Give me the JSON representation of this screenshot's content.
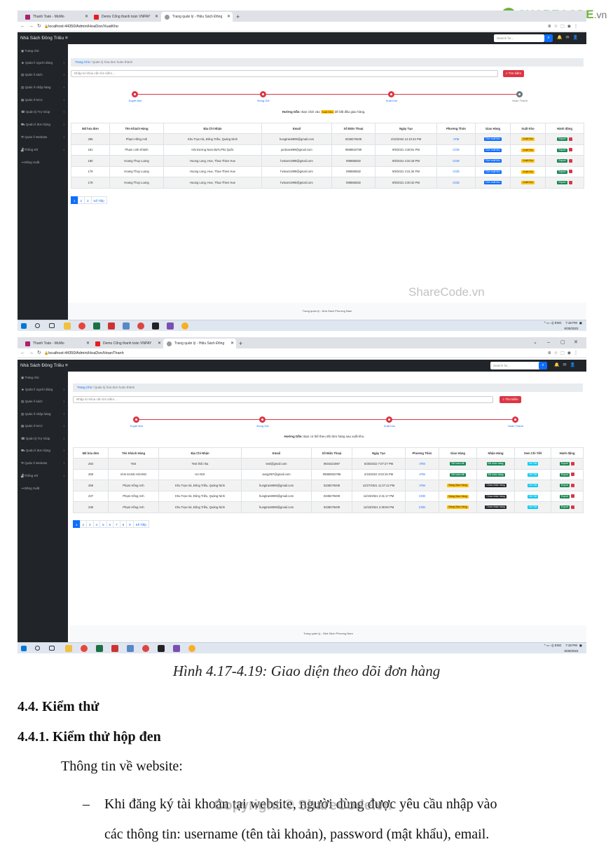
{
  "logo": {
    "brand": "SHARECODE",
    "tld": ".vn"
  },
  "shots": [
    {
      "tabs": [
        "Thanh Toán - MoMo",
        "Demo Cổng thanh toán VNPAY",
        "Trang quản lý - Hiệu Sách Đông"
      ],
      "url": "localhost:44350/Admin/HoaDon/XuatKho",
      "brand": "Nhà Sách Đông Triều",
      "search_placeholder": "Search for...",
      "sidebar": [
        "Trang chủ",
        "Quản lí người dùng",
        "Quản lí sách",
        "Quản lí nhập hàng",
        "Quản lí NCC",
        "Quản lý Trợ Giúp",
        "Quản lí đơn hàng",
        "Quản lí Website",
        "Thống Kê",
        "Đăng Xuất"
      ],
      "breadcrumb_home": "Trang Chủ",
      "breadcrumb_current": "Quản lý hóa đơn hoàn thành",
      "keyword_placeholder": "Nhập từ khóa cần tìm kiếm...",
      "search_button": "Tìm kiếm",
      "steps": [
        "Duyệt đơn",
        "Đóng Gói",
        "Xuất Kho",
        "Hoàn Thành"
      ],
      "guide_label": "Hướng Dẫn:",
      "guide_pre": "Bạn click vào",
      "guide_hl": "Xuất Kho",
      "guide_post": "để bắt đầu giao hàng.",
      "headers": [
        "Mã hóa đơn",
        "Tên Khách Hàng",
        "Địa Chỉ Nhận",
        "Email",
        "Số Điện Thoại",
        "Ngày Tạo",
        "Phương Thức",
        "Giao Hàng",
        "Xuất Kho",
        "Hành động"
      ],
      "rows": [
        [
          "266",
          "Phạm Hồng Anh",
          "Khu Trạo Hà, Đông Triều, Quảng Ninh",
          "hungtran8909@gmail.com",
          "0338279409",
          "1/22/2022 12:10:42 PM",
          "ATM",
          "Chờ xuất kho",
          "Xuất Kho",
          "Export"
        ],
        [
          "181",
          "Phạm Linh Khánh",
          "Hải Dương Nam Định,Phú Quốc",
          "jackson899@gmail.com",
          "0888932789",
          "9/5/2021 4:38:01 PM",
          "COD",
          "Chờ xuất kho",
          "Xuất Kho",
          "Export"
        ],
        [
          "180",
          "Hoang Thuy Luong",
          "Huong Long, Hue, Thua Thien Hue",
          "hvtnam1999@gmail.com",
          "098588282",
          "9/5/2021 4:32:18 PM",
          "COD",
          "Chờ xuất kho",
          "Xuất Kho",
          "Export"
        ],
        [
          "179",
          "Hoang Thuy Luong",
          "Huong Long, Hue, Thua Thien Hue",
          "hvtnam1999@gmail.com",
          "098588282",
          "9/5/2021 4:31:34 PM",
          "COD",
          "Chờ xuất kho",
          "Xuất Kho",
          "Export"
        ],
        [
          "178",
          "Hoang Thuy Luong",
          "Huong Long, Hue, Thua Thien Hue",
          "hvtnam1999@gmail.com",
          "098588282",
          "9/5/2021 4:30:42 PM",
          "COD",
          "Chờ xuất kho",
          "Xuất Kho",
          "Export"
        ]
      ],
      "pages": [
        "1",
        "2",
        "3",
        "Kế Tiếp"
      ],
      "footer": "Trang quản lý - Nhà Sách Phương Nam",
      "watermark": "ShareCode.vn",
      "tray_lang": "ENG",
      "clock_time": "7:18 PM",
      "clock_date": "6/30/2022"
    },
    {
      "tabs": [
        "Thanh Toán - MoMo",
        "Demo Cổng thanh toán VNPAY",
        "Trang quản lý - Hiệu Sách Đông"
      ],
      "url": "localhost:44350/Admin/HoaDon/HoanThanh",
      "brand": "Nhà Sách Đông Triều",
      "search_placeholder": "Search for...",
      "sidebar": [
        "Trang chủ",
        "Quản lí người dùng",
        "Quản lí sách",
        "Quản lí nhập hàng",
        "Quản lí NCC",
        "Quản lý Trợ Giúp",
        "Quản lí đơn hàng",
        "Quản lí Website",
        "Thống Kê",
        "Đăng Xuất"
      ],
      "breadcrumb_home": "Trang Chủ",
      "breadcrumb_current": "Quản lý hóa đơn hoàn thành",
      "keyword_placeholder": "Nhập từ khóa cần tìm kiếm...",
      "search_button": "Tìm kiếm",
      "steps": [
        "Duyệt đơn",
        "Đóng Gói",
        "Xuất Kho",
        "Hoàn Thành"
      ],
      "guide_label": "Hướng Dẫn:",
      "guide_text": "Bạn có thể theo dõi đơn hàng sau xuất kho.",
      "headers": [
        "Mã hóa đơn",
        "Tên Khách Hàng",
        "Địa Chỉ Nhận",
        "Email",
        "Số Điện Thoại",
        "Ngày Tạo",
        "Phương Thức",
        "Giao Hàng",
        "Nhận Hàng",
        "Xem Chi Tiết",
        "Hành động"
      ],
      "rows": [
        [
          "283",
          "Test",
          "Test thôi nha",
          "test@gmail.com",
          "0934321987",
          "6/30/2022 7:07:27 PM",
          "ATM",
          "Đã hoàn tất",
          "Đã nhận hàng",
          "Chi Tiết",
          "Export"
        ],
        [
          "269",
          "VAN SANG HOANG",
          "HA NOI",
          "sangzt97@gmail.com",
          "00880932798",
          "2/15/2022 3:03:15 PM",
          "ATM",
          "Đã hoàn tất",
          "Đã nhận hàng",
          "Chi Tiết",
          "Export"
        ],
        [
          "259",
          "Phạm Hồng Anh",
          "Khu Trạo Hà, Đông Triều, Quảng Ninh",
          "hungtran8909@gmail.com",
          "0338279409",
          "12/27/2021 11:27:12 PM",
          "ATM",
          "Đang Giao Hàng",
          "Chưa nhận hàng",
          "Chi Tiết",
          "Export"
        ],
        [
          "237",
          "Phạm Hồng Anh",
          "Khu Trạo Hà, Đông Triều, Quảng Ninh",
          "hungtran8909@gmail.com",
          "0338279409",
          "12/23/2021 2:41:17 PM",
          "COD",
          "Đang Giao Hàng",
          "Chưa nhận hàng",
          "Chi Tiết",
          "Export"
        ],
        [
          "239",
          "Phạm Hồng Anh",
          "Khu Trạo Hà, Đông Triều, Quảng Ninh",
          "hungtran8909@gmail.com",
          "0338279409",
          "12/23/2021 2:38:56 PM",
          "COD",
          "Đang Giao Hàng",
          "Chưa nhận hàng",
          "Chi Tiết",
          "Export"
        ]
      ],
      "pages": [
        "1",
        "2",
        "3",
        "4",
        "5",
        "6",
        "7",
        "8",
        "9",
        "Kế Tiếp"
      ],
      "footer": "Trang quản lý - Nhà Sách Phương Nam",
      "tray_lang": "ENG",
      "clock_time": "7:18 PM",
      "clock_date": "6/30/2022"
    }
  ],
  "doc": {
    "caption": "Hình 4.17-4.19: Giao diện theo dõi đơn hàng",
    "h1": "4.4.  Kiểm thử",
    "h2": "4.4.1. Kiểm thử hộp đen",
    "intro": "Thông tin về website:",
    "bullet_dash": "–",
    "bullet_line1": "Khi đăng ký tài khoản tại website, người dùng được yêu cầu nhập vào",
    "bullet_line2": "các thông tin: username (tên tài khoản), password (mật khẩu), email.",
    "copyright": "Copyright © ShareCode.vn"
  },
  "colors": {
    "danger": "#dc3545",
    "primary": "#0d6efd",
    "sidebar": "#212529",
    "logo_green": "#6db33f"
  }
}
